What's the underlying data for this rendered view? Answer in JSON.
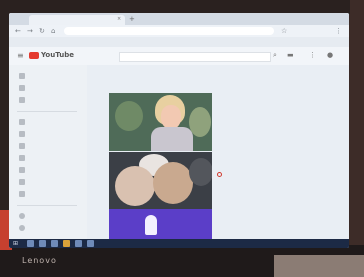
{
  "device": {
    "brand": "Lenovo"
  },
  "browser": {
    "tab_title": "",
    "new_tab_icon": "plus-icon",
    "address": "",
    "bookmarks": [
      "",
      "",
      "",
      "",
      "",
      ""
    ]
  },
  "youtube": {
    "logo_text": "YouTube",
    "search_placeholder": "",
    "sidebar": [
      {
        "icon": "home-icon",
        "label": ""
      },
      {
        "icon": "trending-icon",
        "label": ""
      },
      {
        "icon": "subscriptions-icon",
        "label": ""
      },
      {
        "icon": "library-icon",
        "label": ""
      },
      {
        "icon": "history-icon",
        "label": ""
      },
      {
        "icon": "watch-later-icon",
        "label": ""
      },
      {
        "icon": "playlist-icon",
        "label": ""
      },
      {
        "icon": "playlist-icon",
        "label": ""
      },
      {
        "icon": "playlist-icon",
        "label": ""
      },
      {
        "icon": "playlist-icon",
        "label": ""
      },
      {
        "icon": "channel-icon",
        "label": ""
      },
      {
        "icon": "channel-icon",
        "label": ""
      }
    ],
    "section_title": "",
    "videos": [
      {
        "title": "",
        "meta": "",
        "desc": ""
      },
      {
        "title": "",
        "meta": "",
        "desc": ""
      },
      {
        "title": "",
        "meta": "",
        "desc": ""
      }
    ]
  },
  "taskbar": {
    "tray_text": ""
  }
}
